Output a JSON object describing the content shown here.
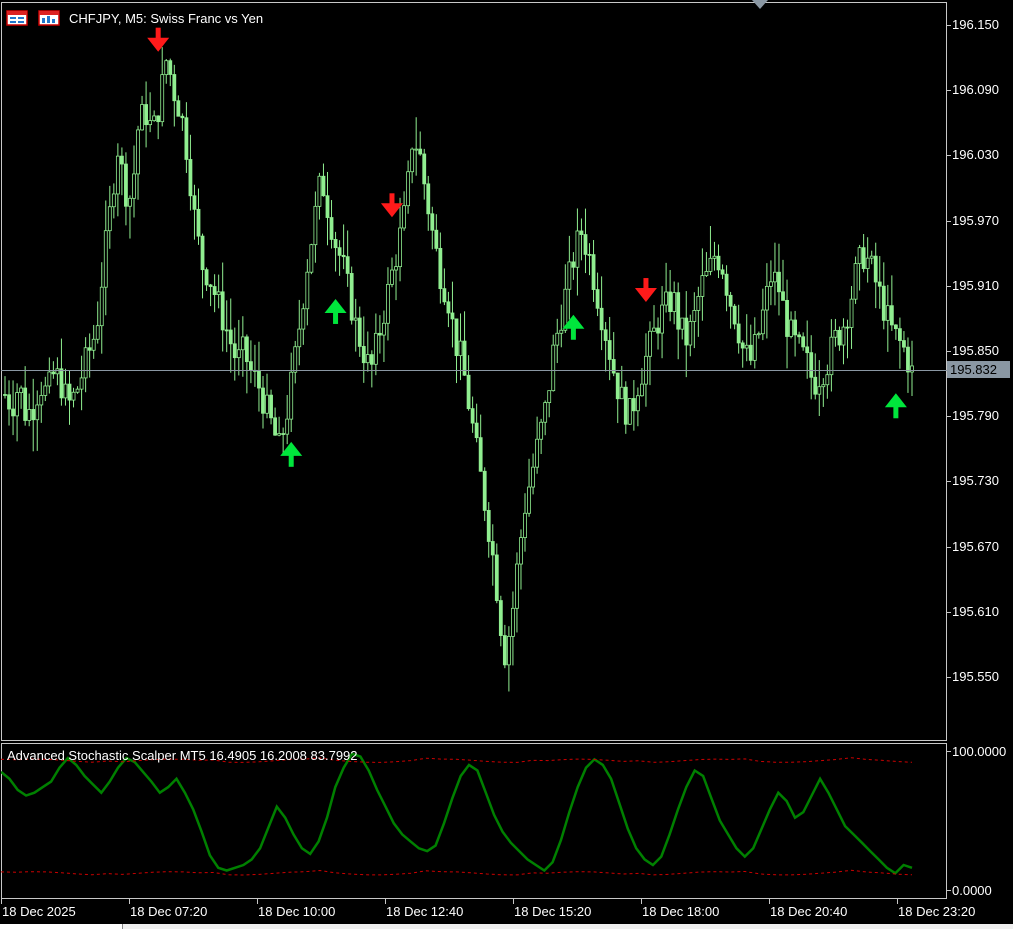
{
  "chart": {
    "symbol_title": "CHFJPY, M5:  Swiss Franc vs Yen",
    "current_price": "195.832",
    "price_axis": [
      "196.150",
      "196.090",
      "196.030",
      "195.970",
      "195.910",
      "195.850",
      "195.790",
      "195.730",
      "195.670",
      "195.610",
      "195.550"
    ],
    "time_axis": [
      "18 Dec 2025",
      "18 Dec 07:20",
      "18 Dec 10:00",
      "18 Dec 12:40",
      "18 Dec 15:20",
      "18 Dec 18:00",
      "18 Dec 20:40",
      "18 Dec 23:20"
    ],
    "colors": {
      "candle": "#90ee90",
      "background": "#000000",
      "grid_frame": "#c8c8c8",
      "sell_arrow": "#ff1a1a",
      "buy_arrow": "#00e63c",
      "stoch_line": "#008000",
      "levels": "#cc0000"
    },
    "signals": [
      {
        "type": "sell",
        "time_index": 38
      },
      {
        "type": "buy",
        "time_index": 71
      },
      {
        "type": "buy",
        "time_index": 82
      },
      {
        "type": "sell",
        "time_index": 96
      },
      {
        "type": "buy",
        "time_index": 141
      },
      {
        "type": "sell",
        "time_index": 159
      },
      {
        "type": "buy",
        "time_index": 221
      }
    ]
  },
  "indicator": {
    "title": "Advanced Stochastic Scalper MT5 16.4905 16.2008 83.7992",
    "axis_top": "100.0000",
    "axis_bottom": "0.0000"
  },
  "chart_data": {
    "type": "candlestick",
    "title": "CHFJPY, M5:  Swiss Franc vs Yen",
    "ylim": [
      195.52,
      196.165
    ],
    "close_path": [
      195.81,
      195.8,
      195.82,
      195.79,
      195.8,
      195.82,
      195.81,
      195.83,
      195.82,
      195.8,
      195.81,
      195.83,
      195.85,
      195.87,
      195.93,
      195.98,
      196.04,
      196.0,
      195.99,
      196.06,
      196.07,
      196.05,
      196.08,
      196.12,
      196.09,
      196.07,
      196.03,
      195.97,
      195.93,
      195.92,
      195.9,
      195.88,
      195.86,
      195.84,
      195.85,
      195.83,
      195.82,
      195.8,
      195.78,
      195.76,
      195.79,
      195.83,
      195.88,
      195.93,
      195.97,
      196.01,
      195.98,
      195.95,
      195.93,
      195.9,
      195.87,
      195.85,
      195.83,
      195.86,
      195.89,
      195.92,
      195.95,
      195.98,
      196.05,
      196.03,
      195.99,
      195.95,
      195.92,
      195.9,
      195.86,
      195.84,
      195.8,
      195.76,
      195.72,
      195.68,
      195.63,
      195.57,
      195.6,
      195.66,
      195.71,
      195.74,
      195.77,
      195.8,
      195.85,
      195.88,
      195.91,
      195.94,
      195.96,
      195.94,
      195.91,
      195.88,
      195.85,
      195.82,
      195.8,
      195.79,
      195.82,
      195.84,
      195.86,
      195.88,
      195.89,
      195.9,
      195.87,
      195.86,
      195.88,
      195.91,
      195.92,
      195.94,
      195.93,
      195.9,
      195.88,
      195.85,
      195.84,
      195.86,
      195.89,
      195.92,
      195.91,
      195.88,
      195.86,
      195.85,
      195.84,
      195.82,
      195.83,
      195.84,
      195.86,
      195.87,
      195.89,
      195.92,
      195.94,
      195.93,
      195.91,
      195.89,
      195.87,
      195.86,
      195.85,
      195.83
    ],
    "stochastic_main": [
      85,
      80,
      72,
      68,
      70,
      74,
      78,
      88,
      95,
      90,
      82,
      76,
      70,
      78,
      88,
      95,
      92,
      85,
      78,
      70,
      74,
      80,
      70,
      58,
      42,
      25,
      16,
      14,
      16,
      18,
      22,
      30,
      45,
      60,
      52,
      40,
      30,
      26,
      35,
      52,
      74,
      88,
      98,
      96,
      86,
      72,
      60,
      48,
      40,
      35,
      30,
      28,
      32,
      48,
      66,
      82,
      90,
      86,
      70,
      54,
      42,
      34,
      28,
      22,
      18,
      14,
      20,
      36,
      56,
      74,
      88,
      94,
      90,
      80,
      62,
      44,
      30,
      22,
      18,
      24,
      40,
      58,
      74,
      86,
      82,
      66,
      50,
      40,
      30,
      24,
      30,
      44,
      58,
      70,
      64,
      52,
      56,
      68,
      80,
      70,
      58,
      46,
      40,
      34,
      28,
      22,
      16,
      12,
      18,
      16
    ],
    "upper_level": 93,
    "lower_level": 12
  }
}
